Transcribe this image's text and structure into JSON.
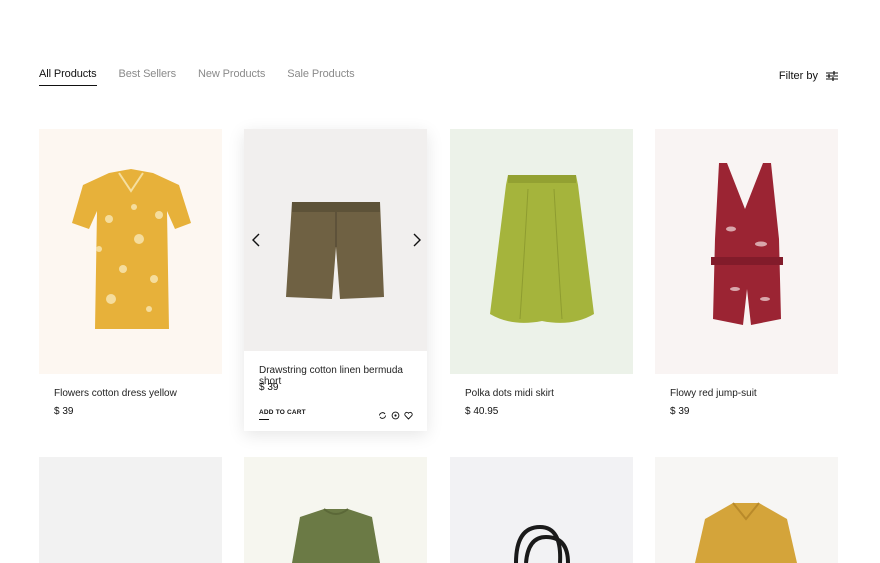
{
  "tabs": [
    {
      "label": "All Products",
      "active": true
    },
    {
      "label": "Best Sellers",
      "active": false
    },
    {
      "label": "New Products",
      "active": false
    },
    {
      "label": "Sale Products",
      "active": false
    }
  ],
  "filter": {
    "label": "Filter by",
    "icon": "sliders-icon"
  },
  "products": [
    {
      "name": "Flowers cotton dress yellow",
      "price": "$ 39",
      "bg": "#fdf7f1",
      "color": "#e7b13a"
    },
    {
      "name": "Drawstring cotton linen bermuda short",
      "price": "$ 39",
      "bg": "#f1efee",
      "color": "#6f6143",
      "add_to_cart": "ADD TO CART"
    },
    {
      "name": "Polka dots midi skirt",
      "price": "$ 40.95",
      "bg": "#ecf2e9",
      "color": "#a5b43c"
    },
    {
      "name": "Flowy red jump-suit",
      "price": "$ 39",
      "bg": "#f9f4f3",
      "color": "#9b2433"
    }
  ],
  "row2": [
    {
      "bg": "#f2f2f2"
    },
    {
      "bg": "#f6f6ef",
      "color": "#6b7a45"
    },
    {
      "bg": "#f2f2f4",
      "color": "#1a1a1a"
    },
    {
      "bg": "#f7f6f4",
      "color": "#d4a43a"
    }
  ]
}
